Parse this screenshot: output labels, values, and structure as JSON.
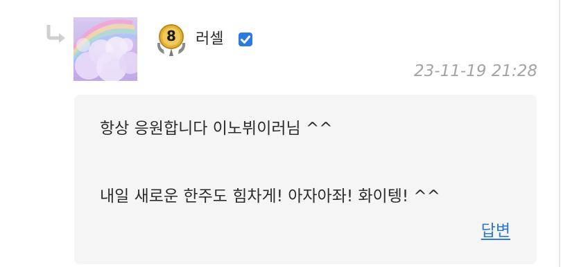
{
  "comment": {
    "level": "8",
    "author": "러셀",
    "timestamp": "23-11-19 21:28",
    "lines": [
      "항상 응원합니다 이노뷔이러님 ^^",
      "내일 새로운 한주도 힘차게! 아자아좌! 화이텡! ^^"
    ],
    "reply_label": "답변"
  },
  "colors": {
    "link": "#2b78d6",
    "timestamp": "#a3a3a3",
    "bubble_bg": "#f5f5f5",
    "verified": "#2a7ae2",
    "badge_gold": "#e2b23a"
  },
  "icons": {
    "reply": "reply-arrow-icon",
    "badge": "level-badge-icon",
    "verified": "verified-check-icon"
  }
}
